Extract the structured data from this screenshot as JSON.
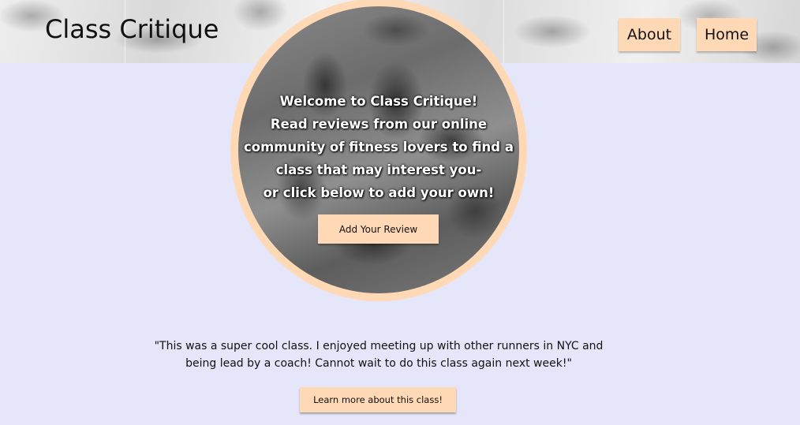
{
  "header": {
    "title": "Class Critique",
    "nav": {
      "about": "About",
      "home": "Home"
    }
  },
  "hero": {
    "lines": [
      "Welcome to Class Critique!",
      "Read reviews from our online",
      "community of fitness lovers to find a",
      "class that may interest you-",
      "or click below to add your own!"
    ],
    "button": "Add Your Review"
  },
  "review": {
    "lines": [
      "\"This was a super cool class. I enjoyed meeting up with other runners in NYC and",
      "being lead by a coach! Cannot wait to do this class again next week!\""
    ],
    "button": "Learn more about this class!"
  },
  "colors": {
    "background": "#e6e6fa",
    "accent": "#ffd8b5"
  }
}
